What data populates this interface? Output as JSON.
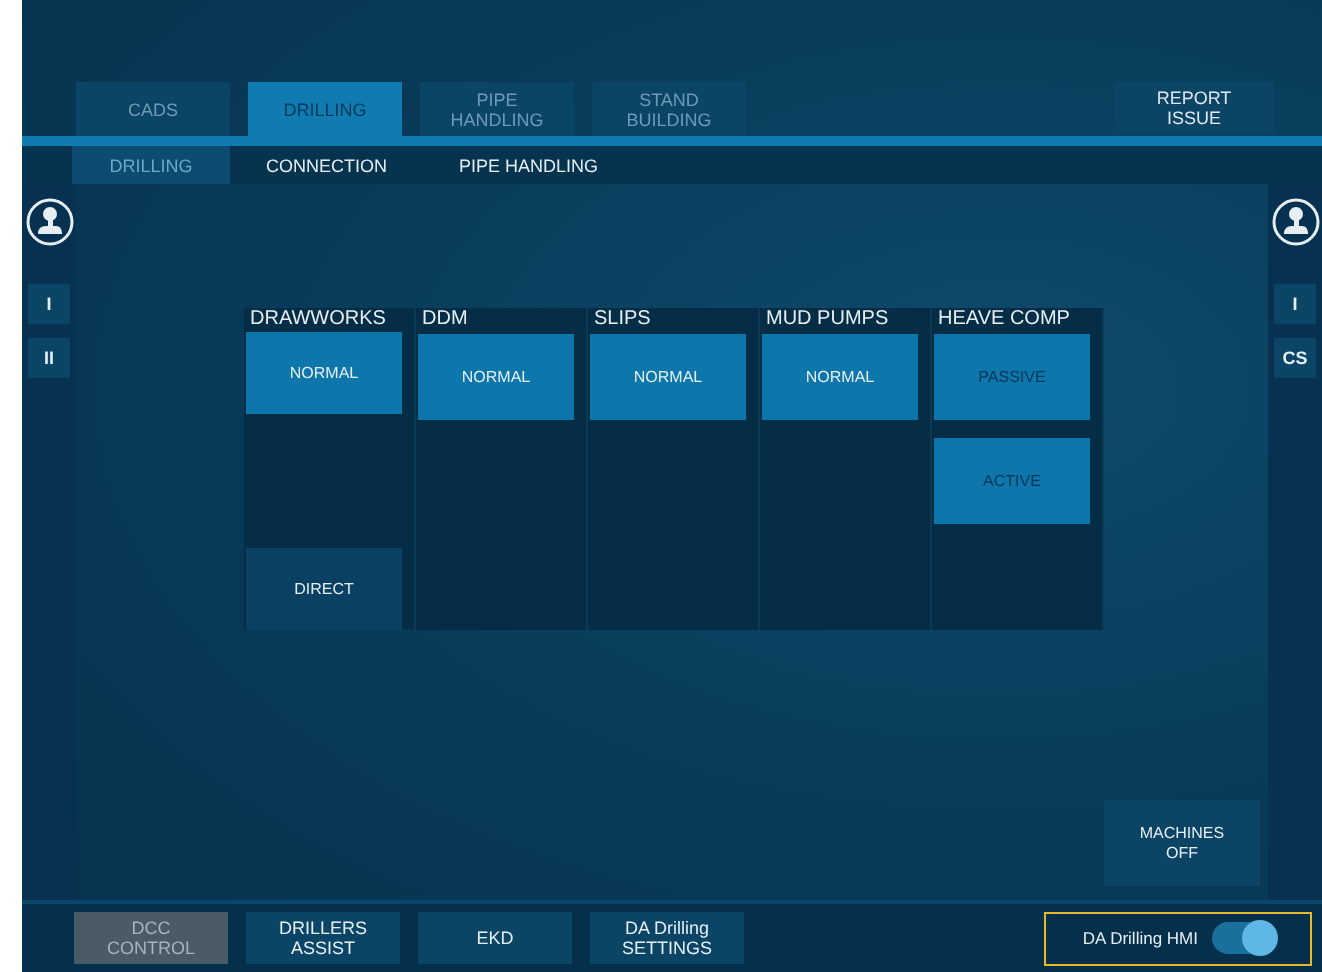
{
  "tabs": [
    {
      "label": "CADS",
      "selected": false
    },
    {
      "label": "DRILLING",
      "selected": true
    },
    {
      "label": "PIPE\nHANDLING",
      "selected": false
    },
    {
      "label": "STAND\nBUILDING",
      "selected": false
    }
  ],
  "report_button": "REPORT\nISSUE",
  "subtabs": [
    {
      "label": "DRILLING",
      "selected": true
    },
    {
      "label": "CONNECTION",
      "selected": false
    },
    {
      "label": "PIPE HANDLING",
      "selected": false
    }
  ],
  "left_rail": [
    "I",
    "II"
  ],
  "right_rail": [
    "I",
    "CS"
  ],
  "machines": [
    {
      "title": "DRAWWORKS",
      "modes": [
        {
          "label": "NORMAL",
          "selected": true,
          "disabled": false
        },
        {
          "kind": "gap"
        },
        {
          "label": "DIRECT",
          "selected": false,
          "disabled": false
        }
      ]
    },
    {
      "title": "DDM",
      "modes": [
        {
          "label": "NORMAL",
          "selected": true,
          "disabled": false
        }
      ]
    },
    {
      "title": "SLIPS",
      "modes": [
        {
          "label": "NORMAL",
          "selected": true,
          "disabled": false
        }
      ]
    },
    {
      "title": "MUD PUMPS",
      "modes": [
        {
          "label": "NORMAL",
          "selected": true,
          "disabled": false
        }
      ]
    },
    {
      "title": "HEAVE COMP",
      "modes": [
        {
          "label": "PASSIVE",
          "selected": true,
          "disabled": true
        },
        {
          "label": "ACTIVE",
          "selected": true,
          "disabled": true
        }
      ]
    }
  ],
  "machines_off": "MACHINES\nOFF",
  "bottom_buttons": [
    {
      "label": "DCC\nCONTROL",
      "disabled": true
    },
    {
      "label": "DRILLERS\nASSIST",
      "disabled": false
    },
    {
      "label": "EKD",
      "disabled": false
    },
    {
      "label": "DA Drilling\nSETTINGS",
      "disabled": false
    }
  ],
  "hmi_toggle": {
    "label": "DA Drilling HMI",
    "on": true
  }
}
